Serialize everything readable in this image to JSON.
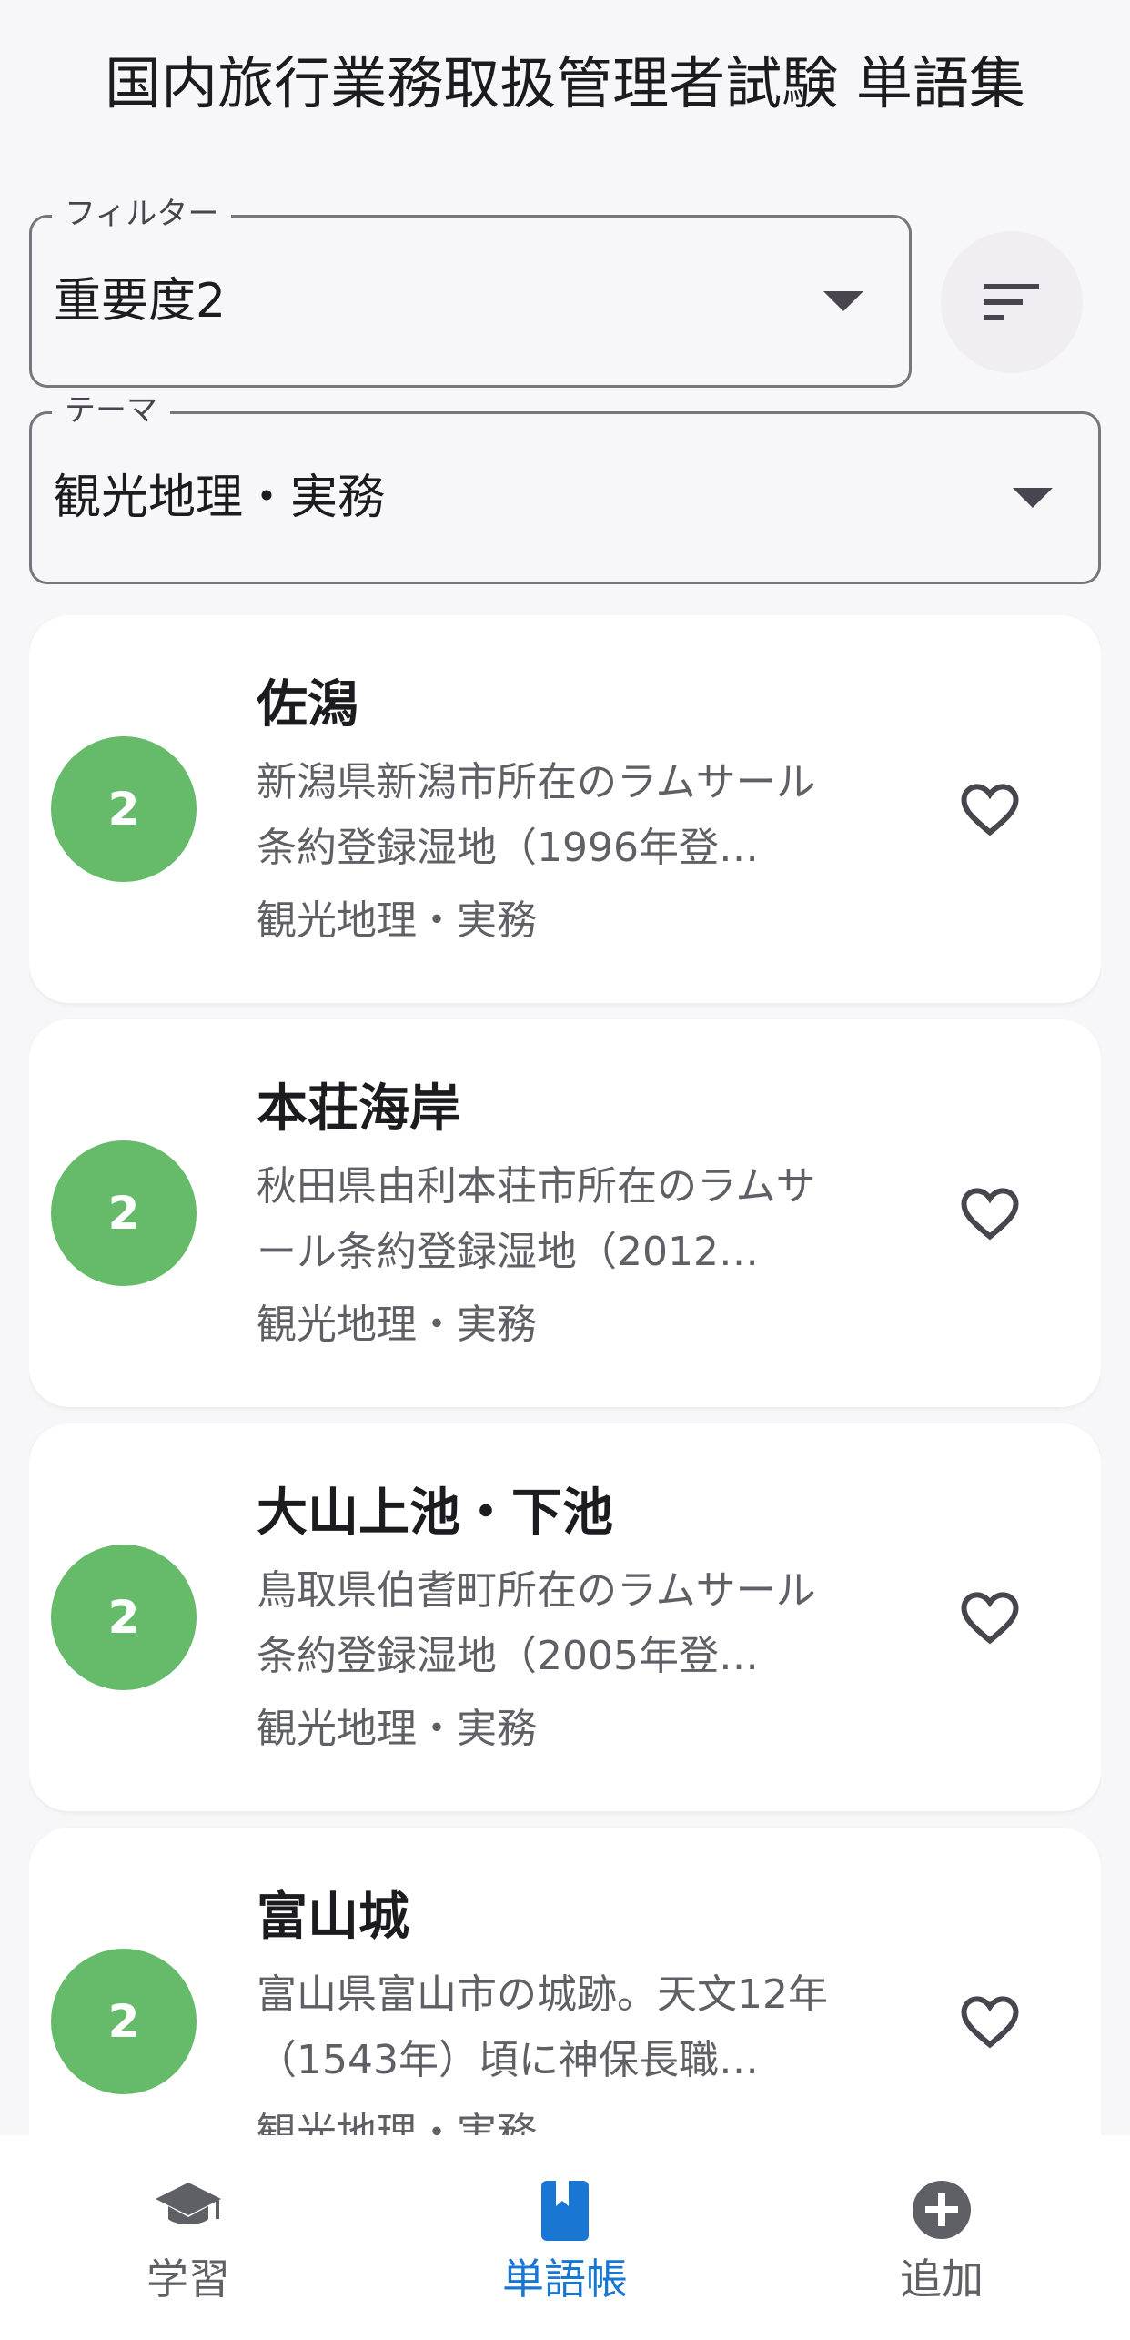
{
  "app": {
    "title": "国内旅行業務取扱管理者試験 単語集"
  },
  "filter": {
    "label": "フィルター",
    "value": "重要度2"
  },
  "theme": {
    "label": "テーマ",
    "value": "観光地理・実務"
  },
  "colors": {
    "badge": "#66bb6a",
    "active_nav": "#1976d2"
  },
  "cards": [
    {
      "badge": "2",
      "term": "佐潟",
      "desc": "新潟県新潟市所在のラムサール条約登録湿地（1996年登…",
      "theme": "観光地理・実務"
    },
    {
      "badge": "2",
      "term": "本荘海岸",
      "desc": "秋田県由利本荘市所在のラムサール条約登録湿地（2012…",
      "theme": "観光地理・実務"
    },
    {
      "badge": "2",
      "term": "大山上池・下池",
      "desc": "鳥取県伯耆町所在のラムサール条約登録湿地（2005年登…",
      "theme": "観光地理・実務"
    },
    {
      "badge": "2",
      "term": "富山城",
      "desc": "富山県富山市の城跡。天文12年（1543年）頃に神保長職…",
      "theme": "観光地理・実務"
    }
  ],
  "nav": [
    {
      "label": "学習",
      "icon": "graduation-cap-icon",
      "active": false
    },
    {
      "label": "単語帳",
      "icon": "bookmark-book-icon",
      "active": true
    },
    {
      "label": "追加",
      "icon": "add-circle-icon",
      "active": false
    }
  ]
}
